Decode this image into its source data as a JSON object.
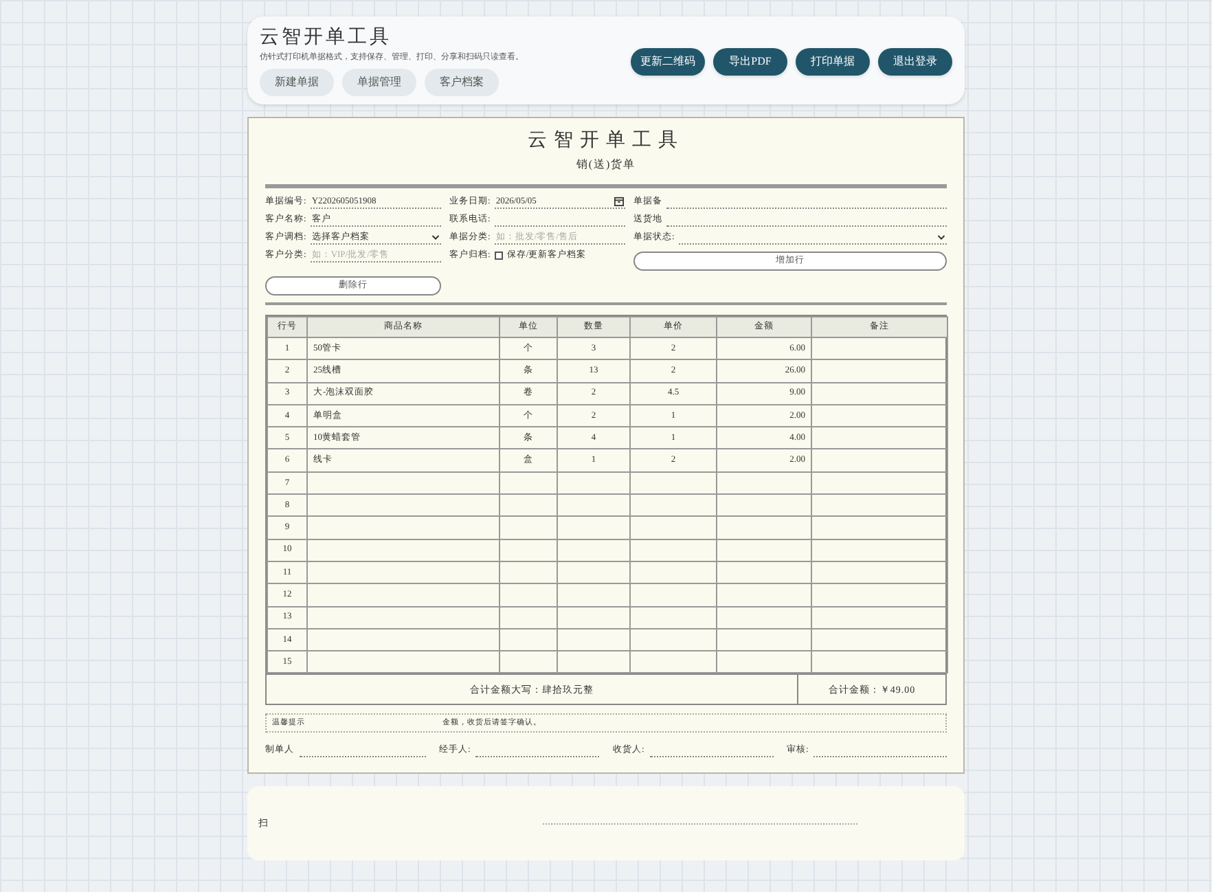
{
  "header": {
    "title": "云智开单工具",
    "subtitle": "仿针式打印机单据格式，支持保存、管理、打印、分享和扫码只读查看。",
    "nav_buttons": [
      "新建单据",
      "单据管理",
      "客户档案"
    ],
    "action_buttons": [
      "更新二维码",
      "导出PDF",
      "打印单据",
      "退出登录"
    ]
  },
  "paper": {
    "title": "云智开单工具",
    "subtitle": "销(送)货单",
    "fields": [
      {
        "kind": "text",
        "label": "单据编号:",
        "value": "Y2202605051908"
      },
      {
        "kind": "date",
        "label": "业务日期:",
        "value": "2026/05/05"
      },
      {
        "kind": "text",
        "label": "单据备"
      },
      {
        "kind": "text",
        "label": "客户名称:",
        "value": "客户"
      },
      {
        "kind": "text",
        "label": "联系电话:"
      },
      {
        "kind": "text",
        "label": "送货地"
      },
      {
        "kind": "select",
        "label": "客户调档:",
        "value": "选择客户档案"
      },
      {
        "kind": "text",
        "label": "单据分类:",
        "placeholder": "如：批发/零售/售后"
      },
      {
        "kind": "select",
        "label": "单据状态:"
      },
      {
        "kind": "text",
        "label": "客户分类:",
        "placeholder": "如：VIP/批发/零售"
      },
      {
        "kind": "checkbox",
        "label": "客户归档:",
        "option": "保存/更新客户档案",
        "checked": false
      },
      {
        "kind": "button",
        "label": "增加行"
      },
      {
        "kind": "button",
        "label": "删除行"
      }
    ],
    "table": {
      "columns": [
        "行号",
        "商品名称",
        "单位",
        "数量",
        "单价",
        "金额",
        "备注"
      ],
      "rows": [
        [
          "1",
          "50管卡",
          "个",
          "3",
          "2",
          "6.00",
          ""
        ],
        [
          "2",
          "25线槽",
          "条",
          "13",
          "2",
          "26.00",
          ""
        ],
        [
          "3",
          "大-泡沫双面胶",
          "卷",
          "2",
          "4.5",
          "9.00",
          ""
        ],
        [
          "4",
          "单明盒",
          "个",
          "2",
          "1",
          "2.00",
          ""
        ],
        [
          "5",
          "10黄蜡套管",
          "条",
          "4",
          "1",
          "4.00",
          ""
        ],
        [
          "6",
          "线卡",
          "盒",
          "1",
          "2",
          "2.00",
          ""
        ],
        [
          "7",
          "",
          "",
          "",
          "",
          "",
          ""
        ],
        [
          "8",
          "",
          "",
          "",
          "",
          "",
          ""
        ],
        [
          "9",
          "",
          "",
          "",
          "",
          "",
          ""
        ],
        [
          "10",
          "",
          "",
          "",
          "",
          "",
          ""
        ],
        [
          "11",
          "",
          "",
          "",
          "",
          "",
          ""
        ],
        [
          "12",
          "",
          "",
          "",
          "",
          "",
          ""
        ],
        [
          "13",
          "",
          "",
          "",
          "",
          "",
          ""
        ],
        [
          "14",
          "",
          "",
          "",
          "",
          "",
          ""
        ],
        [
          "15",
          "",
          "",
          "",
          "",
          "",
          ""
        ]
      ],
      "total_words": "合计金额大写：肆拾玖元整",
      "total": "合计金额：￥49.00"
    },
    "notice": [
      "温馨提示",
      "金额，收货后请签字确认。"
    ],
    "signatures": [
      "制单人",
      "经手人:",
      "收货人:",
      "审核:"
    ]
  },
  "share": {
    "label": "扫"
  }
}
